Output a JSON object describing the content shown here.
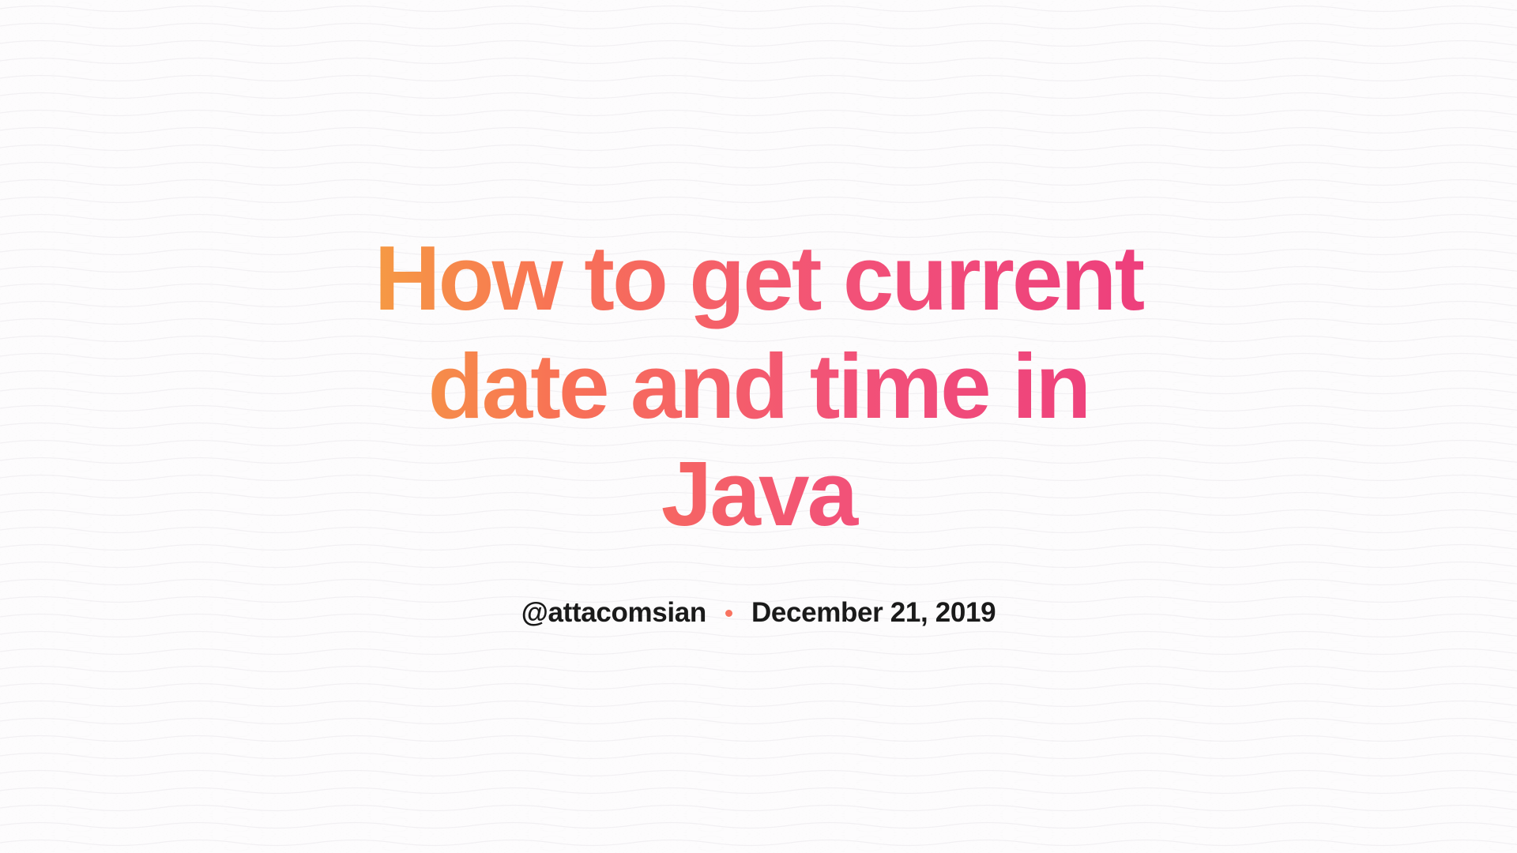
{
  "article": {
    "title": "How to get current date and time in Java",
    "author_handle": "@attacomsian",
    "published_date": "December 21, 2019"
  }
}
